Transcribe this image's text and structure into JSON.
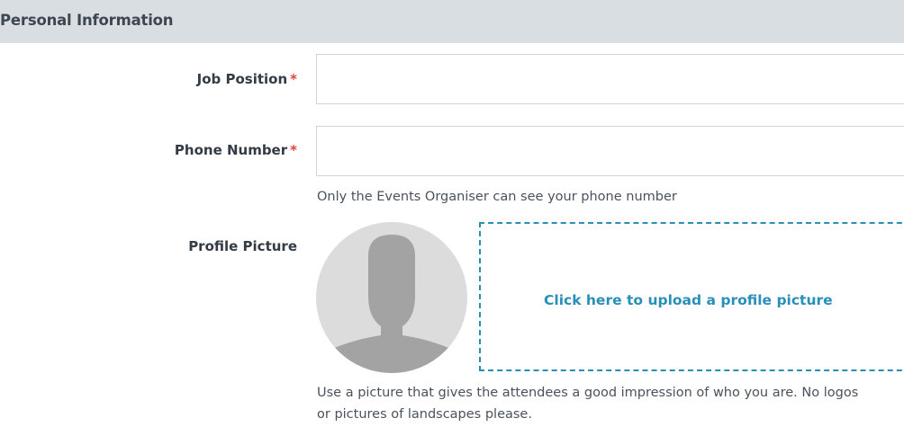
{
  "section": {
    "title": "Personal Information"
  },
  "fields": {
    "job_position": {
      "label": "Job Position",
      "required_marker": "*",
      "value": ""
    },
    "phone_number": {
      "label": "Phone Number",
      "required_marker": "*",
      "value": "",
      "help": "Only the Events Organiser can see your phone number"
    },
    "profile_picture": {
      "label": "Profile Picture",
      "upload_label": "Click here to upload a profile picture",
      "help": "Use a picture that gives the attendees a good impression of who you are. No logos or pictures of landscapes please.",
      "avatar_icon": "default-user-avatar-icon"
    }
  },
  "colors": {
    "header_bg": "#d9dee3",
    "required": "#e0433b",
    "accent": "#2a8fb7",
    "input_border": "#cfd4d9"
  }
}
